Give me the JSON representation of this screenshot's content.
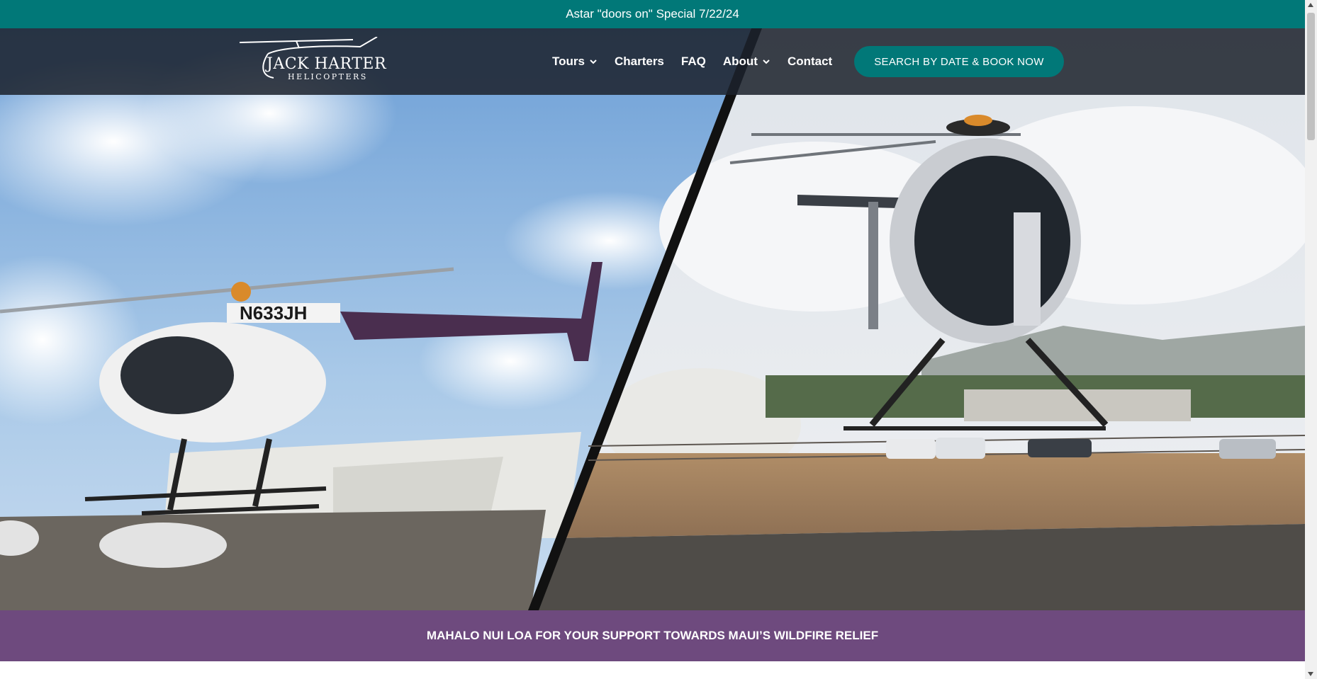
{
  "announcement": {
    "text": "Astar \"doors on\" Special 7/22/24"
  },
  "logo": {
    "line1": "JACK HARTER",
    "line2": "HELICOPTERS"
  },
  "nav": {
    "items": [
      {
        "label": "Tours",
        "has_dropdown": true
      },
      {
        "label": "Charters",
        "has_dropdown": false
      },
      {
        "label": "FAQ",
        "has_dropdown": false
      },
      {
        "label": "About",
        "has_dropdown": true
      },
      {
        "label": "Contact",
        "has_dropdown": false
      }
    ],
    "cta_label": "SEARCH BY DATE & BOOK NOW"
  },
  "hero": {
    "left_tail_number": "N633JH"
  },
  "banner": {
    "text": "MAHALO NUI LOA FOR YOUR SUPPORT TOWARDS MAUI’S WILDFIRE RELIEF"
  },
  "colors": {
    "teal": "#017878",
    "purple": "#6e4a7e",
    "header_bg": "#1c222c"
  }
}
